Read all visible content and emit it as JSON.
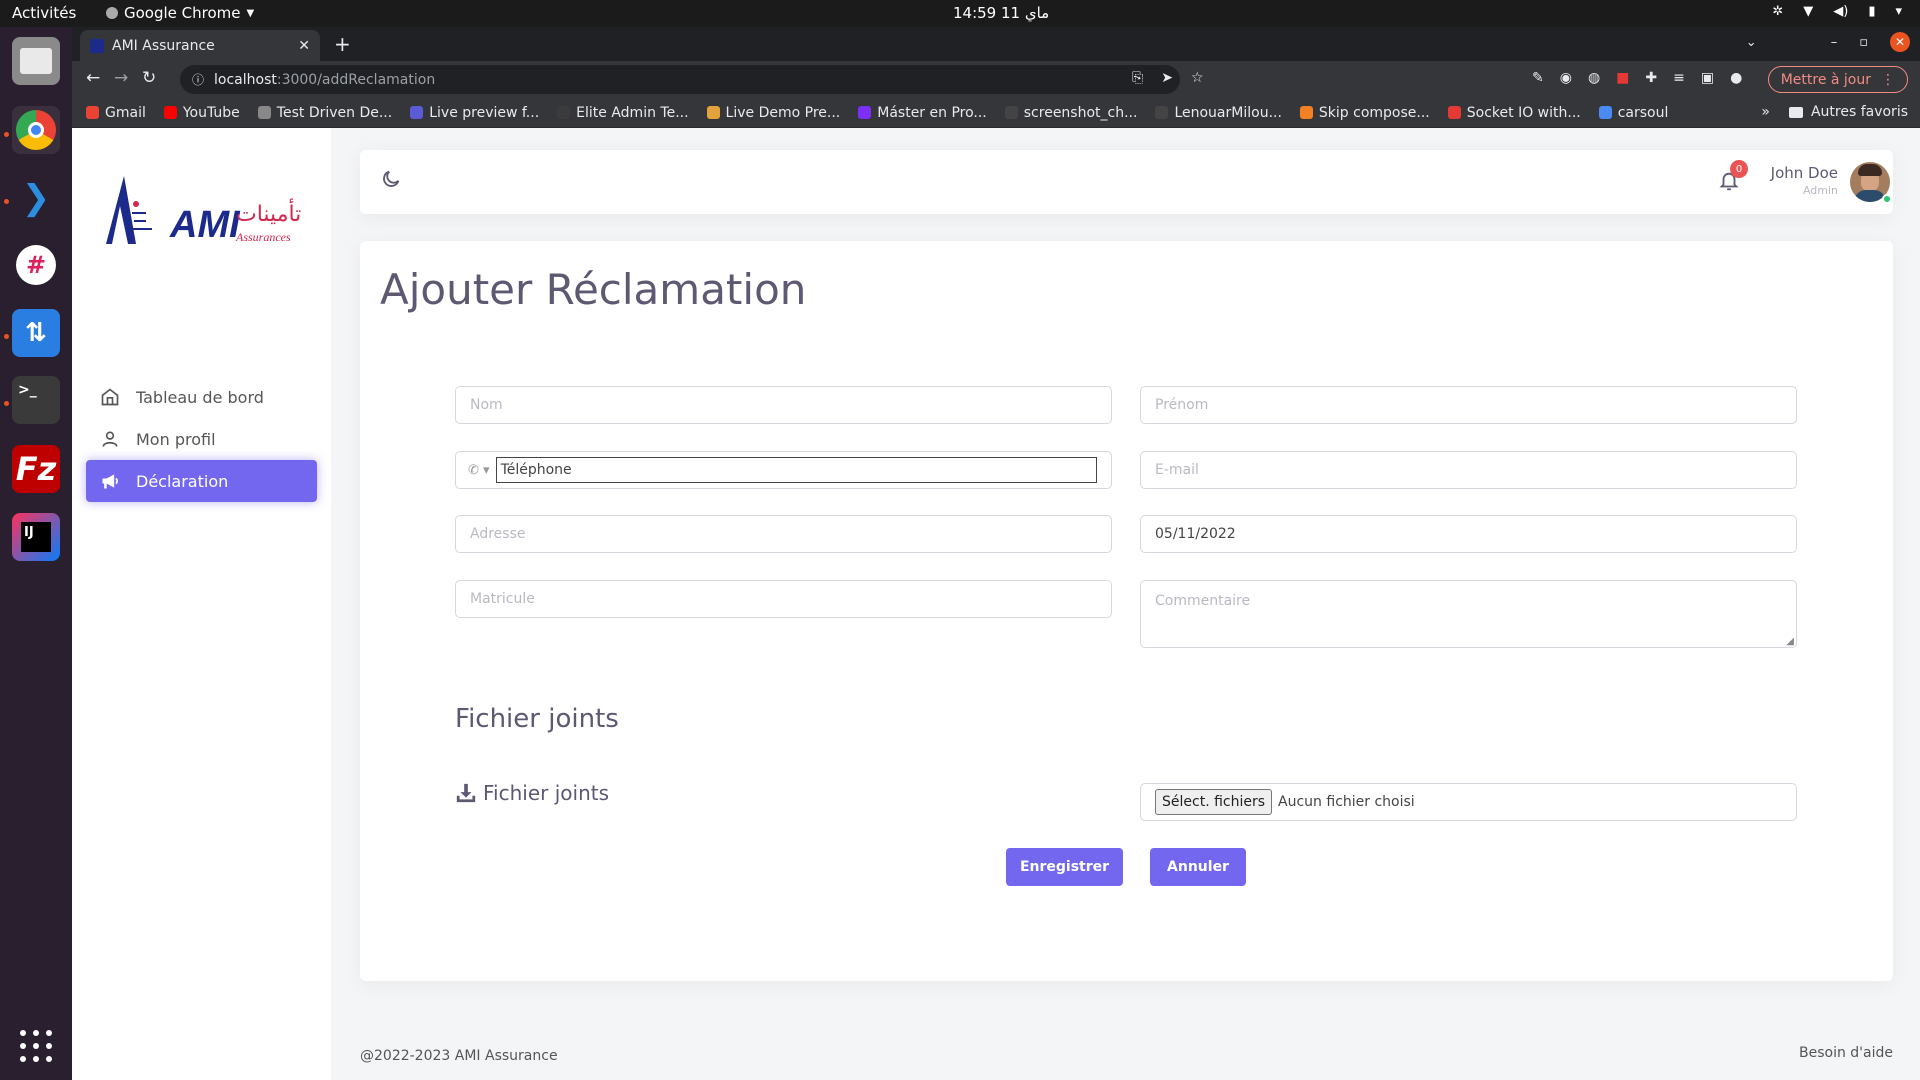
{
  "os": {
    "activities": "Activités",
    "app_name": "Google Chrome",
    "clock": "14:59  11 ماي"
  },
  "browser": {
    "tab_title": "AMI Assurance",
    "url_host": "localhost",
    "url_path": ":3000/addReclamation",
    "update_label": "Mettre à jour",
    "bookmarks": [
      {
        "label": "Gmail",
        "color": "#ea4335"
      },
      {
        "label": "YouTube",
        "color": "#ff0000"
      },
      {
        "label": "Test Driven De...",
        "color": "#888888"
      },
      {
        "label": "Live preview f...",
        "color": "#5b5bd6"
      },
      {
        "label": "Elite Admin Te...",
        "color": "#3b3b3b"
      },
      {
        "label": "Live Demo Pre...",
        "color": "#e3a33b"
      },
      {
        "label": "Máster en Pro...",
        "color": "#7b2ff7"
      },
      {
        "label": "screenshot_ch...",
        "color": "#444444"
      },
      {
        "label": "LenouarMilou...",
        "color": "#444444"
      },
      {
        "label": "Skip compose...",
        "color": "#f48024"
      },
      {
        "label": "Socket IO with...",
        "color": "#e53935"
      },
      {
        "label": "carsoul",
        "color": "#4a8af4"
      }
    ],
    "bookmarks_more": "»",
    "other_bookmarks": "Autres favoris"
  },
  "app": {
    "logo_text": "AMI",
    "logo_sub": "Assurances",
    "logo_arabic": "تأمينات",
    "menu": [
      {
        "label": "Tableau de bord",
        "icon": "home-icon"
      },
      {
        "label": "Mon profil",
        "icon": "user-icon"
      },
      {
        "label": "Déclaration",
        "icon": "megaphone-icon"
      }
    ],
    "active_menu_index": 2,
    "notifications_count": "0",
    "user_name": "John Doe",
    "user_role": "Admin",
    "accent_color": "#7367f0"
  },
  "form": {
    "title": "Ajouter Réclamation",
    "nom_placeholder": "Nom",
    "prenom_placeholder": "Prénom",
    "telephone_placeholder": "Téléphone",
    "email_placeholder": "E-mail",
    "adresse_placeholder": "Adresse",
    "date_value": "05/11/2022",
    "matricule_placeholder": "Matricule",
    "commentaire_placeholder": "Commentaire",
    "section_title": "Fichier joints",
    "attach_label": "Fichier joints",
    "file_button": "Sélect. fichiers",
    "file_status": "Aucun fichier choisi",
    "save_label": "Enregistrer",
    "cancel_label": "Annuler"
  },
  "footer": {
    "copyright": "@2022-2023 AMI Assurance",
    "help": "Besoin d'aide"
  }
}
